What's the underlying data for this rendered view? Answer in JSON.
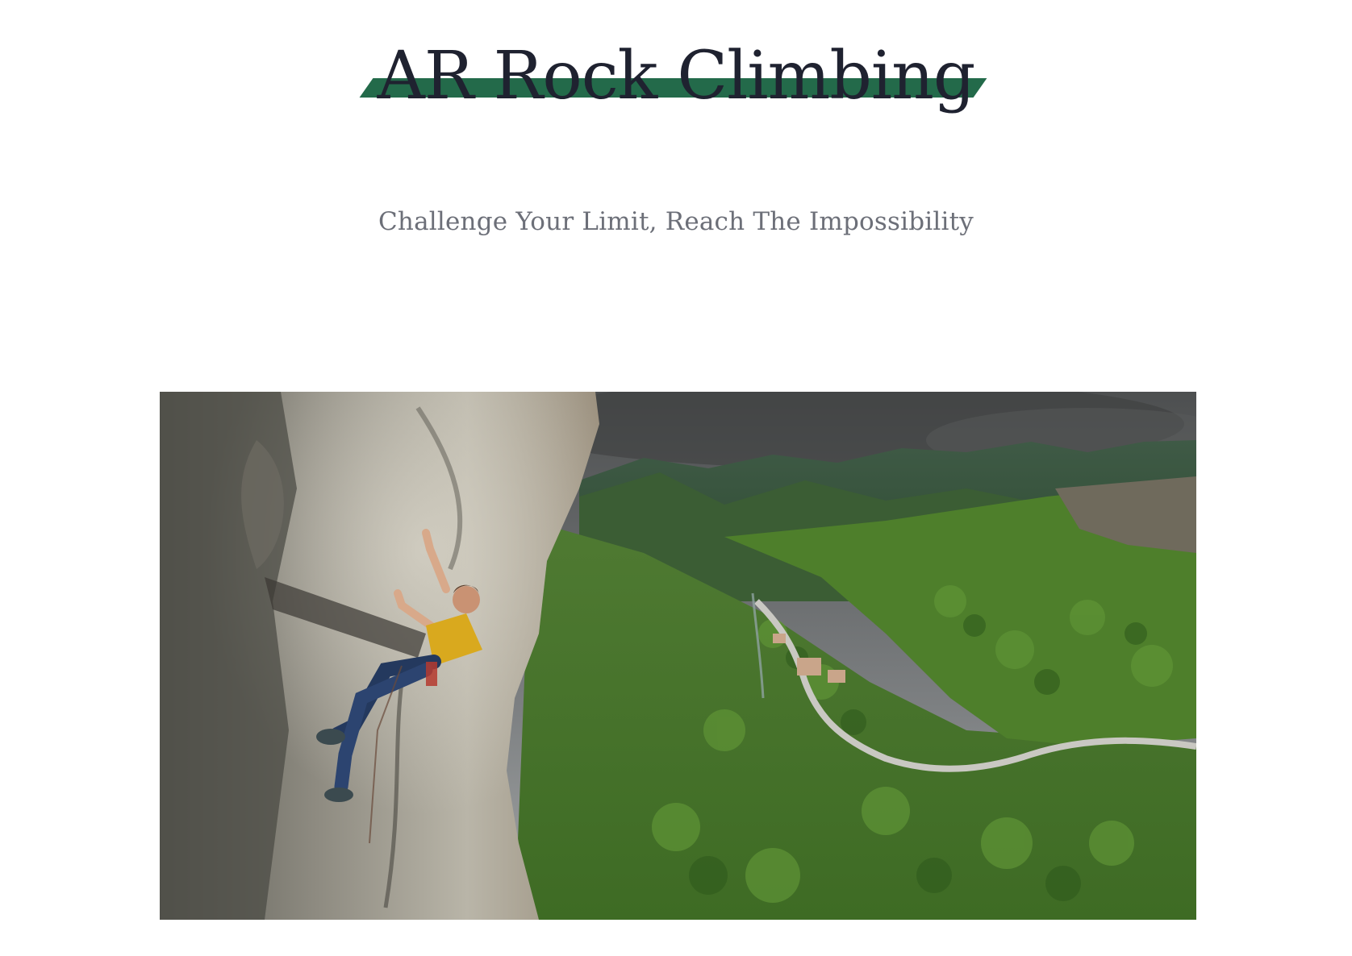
{
  "site": {
    "title": "AR Rock Climbing",
    "tagline": "Challenge Your Limit, Reach The Impossibility",
    "accent_color": "#236a4a",
    "title_color": "#1f2230",
    "tagline_color": "#6c6f78"
  },
  "hero": {
    "icon": "rock-climber-photo",
    "depicts": "climber-on-cliff-above-valley"
  }
}
